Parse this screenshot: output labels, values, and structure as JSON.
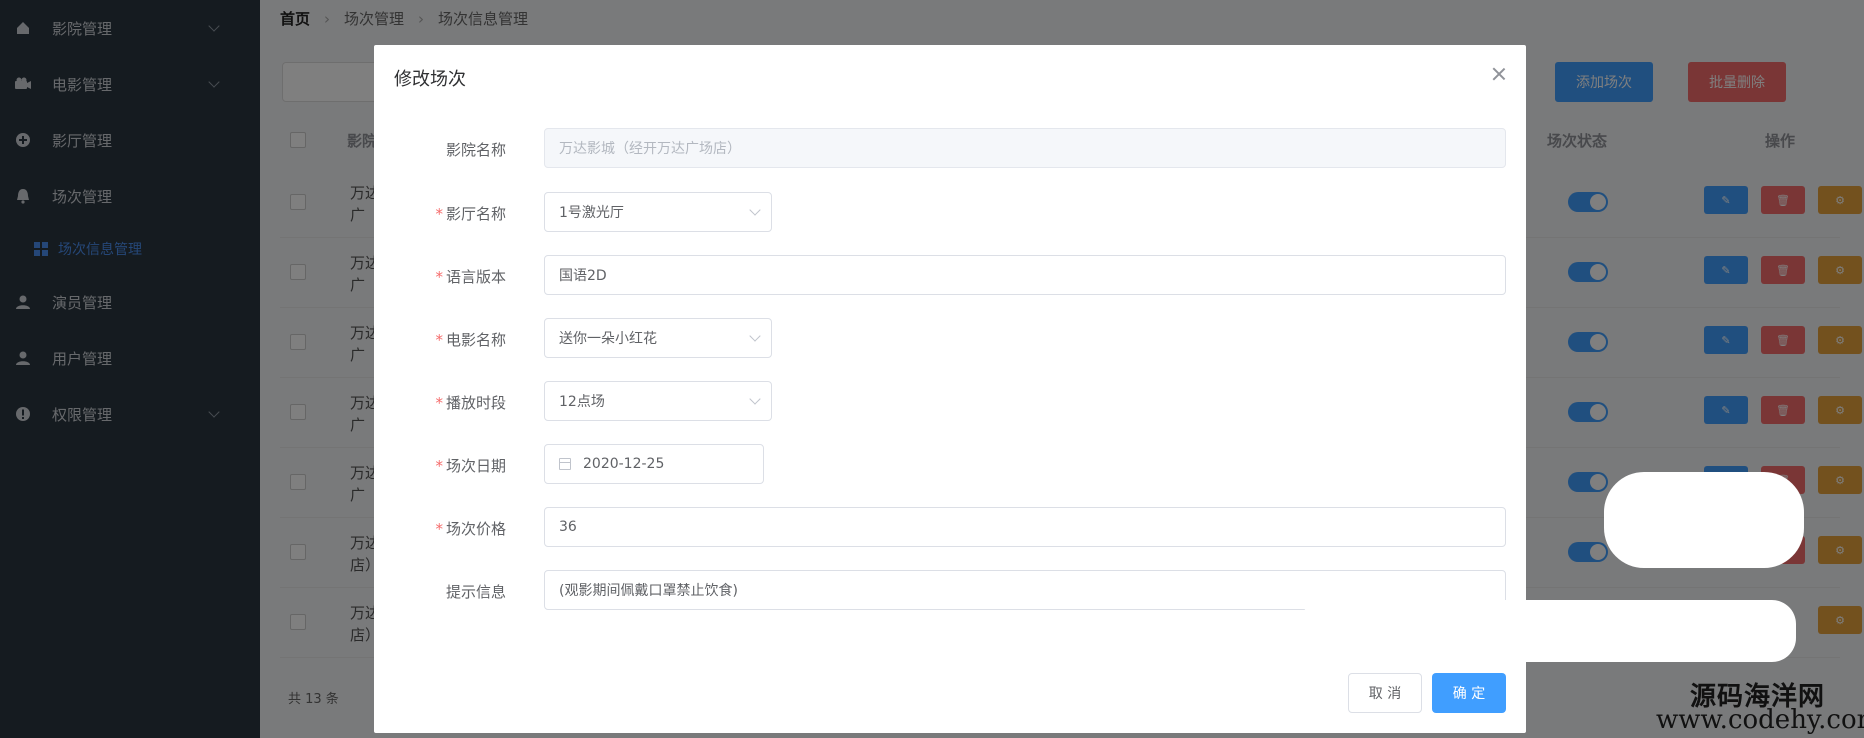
{
  "sidebar": {
    "items": [
      {
        "label": "影院管理",
        "icon": "home-icon",
        "has_arrow": true
      },
      {
        "label": "电影管理",
        "icon": "film-icon",
        "has_arrow": true
      },
      {
        "label": "影厅管理",
        "icon": "circle-plus-icon",
        "has_arrow": false
      },
      {
        "label": "场次管理",
        "icon": "bell-icon",
        "has_arrow": false
      },
      {
        "label": "演员管理",
        "icon": "user-icon",
        "has_arrow": false
      },
      {
        "label": "用户管理",
        "icon": "user-icon",
        "has_arrow": false
      },
      {
        "label": "权限管理",
        "icon": "info-icon",
        "has_arrow": true
      }
    ],
    "active_sub": {
      "label": "场次信息管理",
      "icon": "grid-icon"
    }
  },
  "breadcrumb": {
    "home": "首页",
    "level1": "场次管理",
    "level2": "场次信息管理"
  },
  "toolbar": {
    "add_label": "添加场次",
    "batch_delete_label": "批量删除"
  },
  "table": {
    "headers": {
      "cinema": "影院",
      "status": "场次状态",
      "operation": "操作"
    },
    "rows": [
      {
        "name": "万达广"
      },
      {
        "name": "万达广"
      },
      {
        "name": "万达广"
      },
      {
        "name": "万达广"
      },
      {
        "name": "万达广"
      },
      {
        "name": "万达店）"
      },
      {
        "name": "万达店）"
      }
    ],
    "total": "共 13 条"
  },
  "dialog": {
    "title": "修改场次",
    "fields": {
      "cinema": {
        "label": "影院名称",
        "value": "万达影城（经开万达广场店）",
        "required": false
      },
      "hall": {
        "label": "影厅名称",
        "value": "1号激光厅",
        "required": true
      },
      "language": {
        "label": "语言版本",
        "value": "国语2D",
        "required": true
      },
      "movie": {
        "label": "电影名称",
        "value": "送你一朵小红花",
        "required": true
      },
      "time_slot": {
        "label": "播放时段",
        "value": "12点场",
        "required": true
      },
      "date": {
        "label": "场次日期",
        "value": "2020-12-25",
        "required": true
      },
      "price": {
        "label": "场次价格",
        "value": "36",
        "required": true
      },
      "tip": {
        "label": "提示信息",
        "value": "(观影期间佩戴口罩禁止饮食)",
        "required": false
      }
    },
    "cancel_label": "取 消",
    "confirm_label": "确 定"
  },
  "watermark": {
    "line1": "源码海洋网",
    "line2": "www.codehy.com"
  },
  "colors": {
    "primary": "#409eff",
    "danger": "#f56c6c",
    "warning": "#e6a23c",
    "required": "#f56c6c"
  }
}
